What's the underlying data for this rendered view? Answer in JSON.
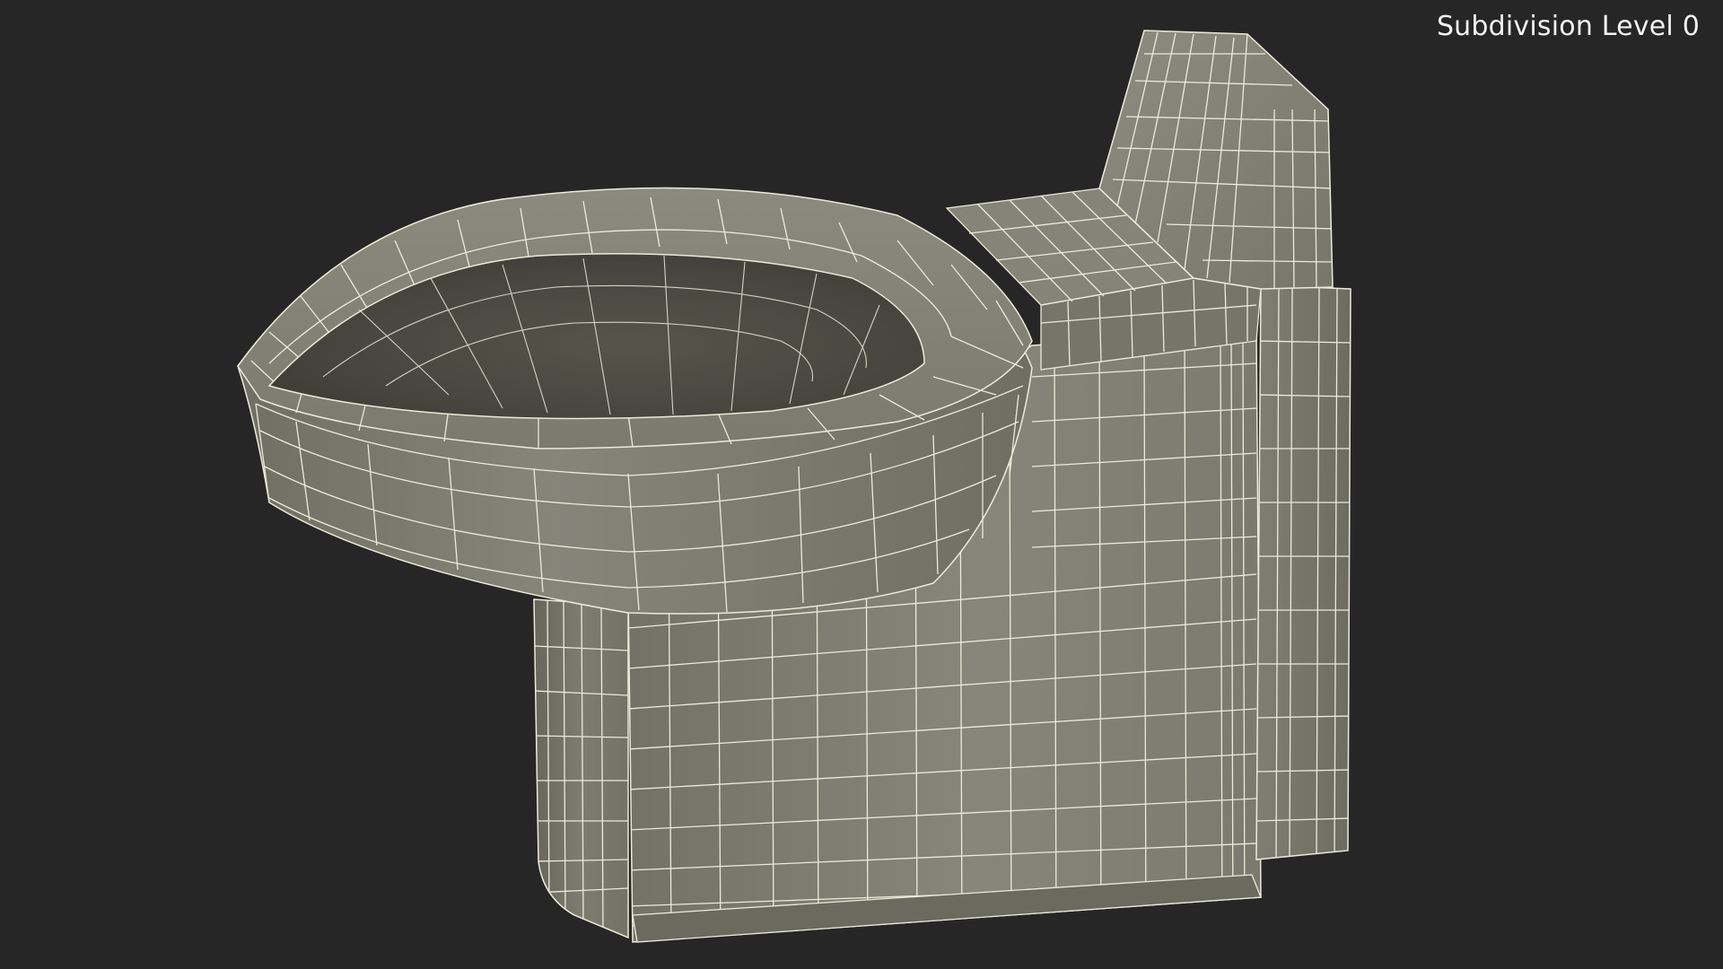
{
  "viewport": {
    "overlay_label": "Subdivision Level 0",
    "background_color": "#262626"
  },
  "model": {
    "subject": "wall-mounted-toilet",
    "render_style": "wireframe-on-shaded",
    "surface_color": "#7d7d6f",
    "shadow_color": "#5e5e53",
    "wire_color": "#ecebd8"
  }
}
